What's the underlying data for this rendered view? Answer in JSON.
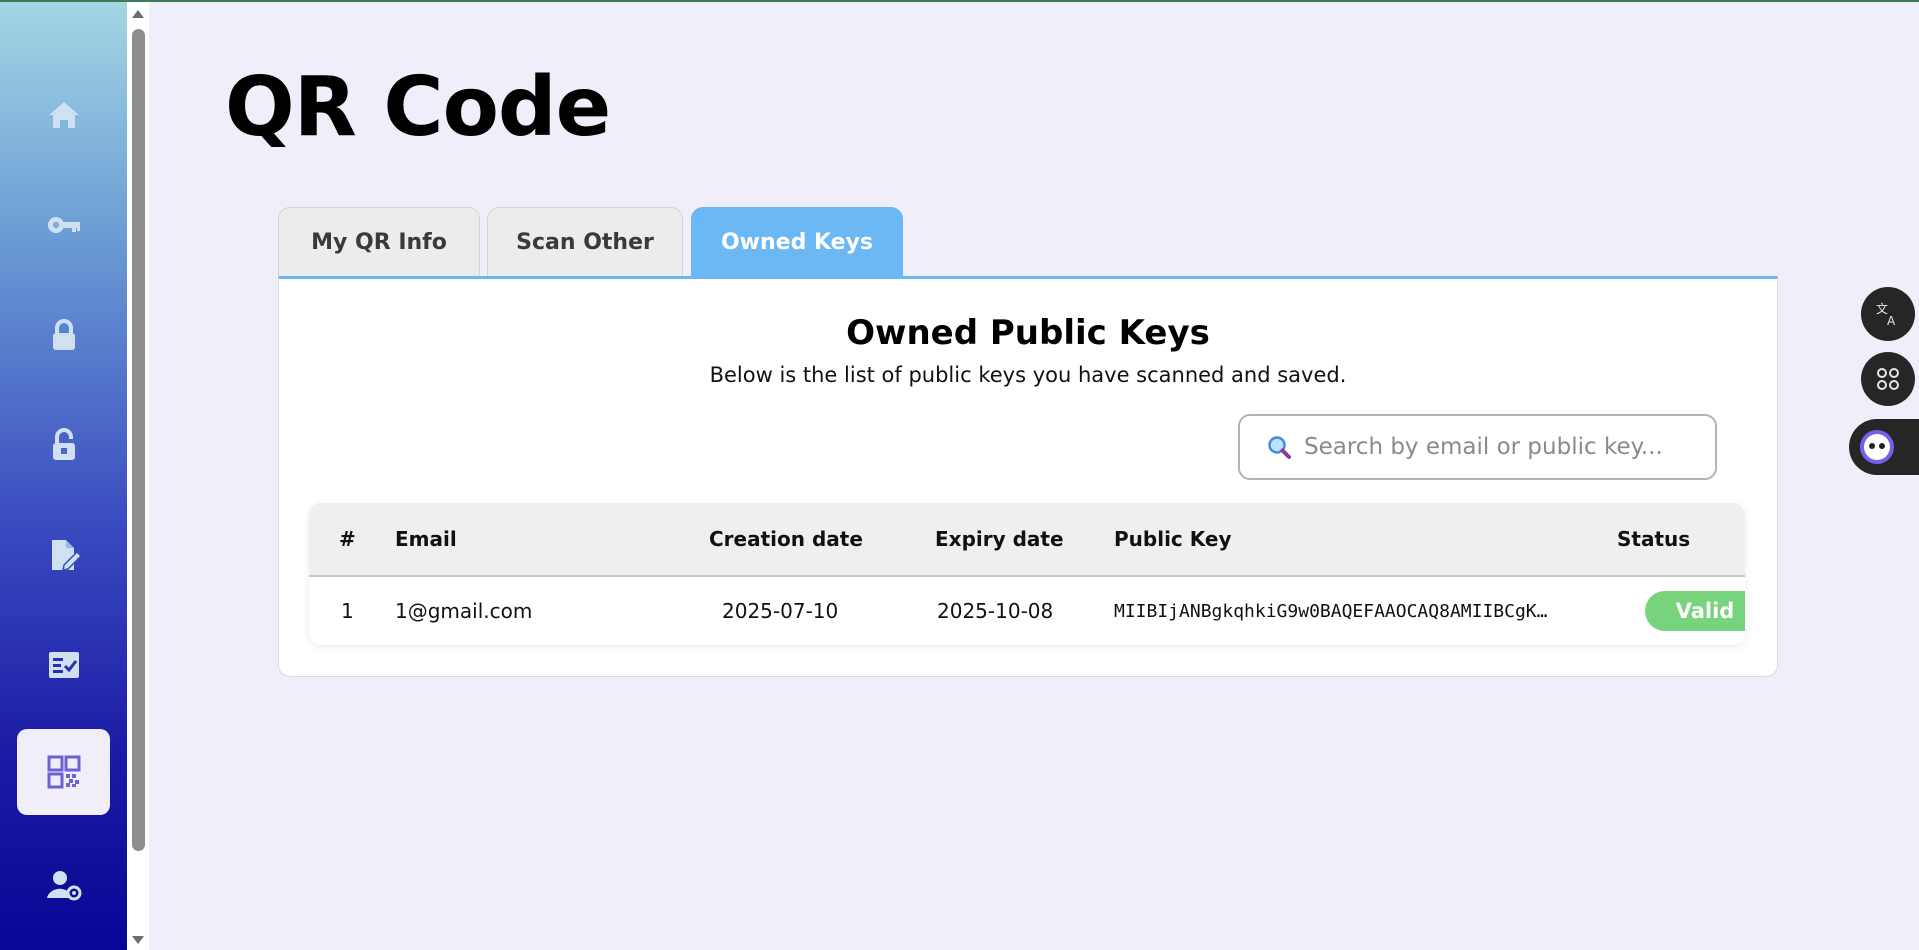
{
  "page": {
    "title": "QR Code"
  },
  "sidebar": {
    "items": [
      {
        "icon": "home-icon",
        "active": false
      },
      {
        "icon": "key-icon",
        "active": false
      },
      {
        "icon": "lock-icon",
        "active": false
      },
      {
        "icon": "unlock-icon",
        "active": false
      },
      {
        "icon": "sign-document-icon",
        "active": false
      },
      {
        "icon": "checklist-icon",
        "active": false
      },
      {
        "icon": "qr-code-icon",
        "active": true
      },
      {
        "icon": "user-settings-icon",
        "active": false
      }
    ]
  },
  "tabs": [
    {
      "label": "My QR Info",
      "active": false
    },
    {
      "label": "Scan Other",
      "active": false
    },
    {
      "label": "Owned Keys",
      "active": true
    }
  ],
  "panel": {
    "heading": "Owned Public Keys",
    "subtitle": "Below is the list of public keys you have scanned and saved.",
    "search": {
      "placeholder": "Search by email or public key...",
      "value": ""
    }
  },
  "table": {
    "columns": [
      "#",
      "Email",
      "Creation date",
      "Expiry date",
      "Public Key",
      "Status"
    ],
    "rows": [
      {
        "index": "1",
        "email": "1@gmail.com",
        "created": "2025-07-10",
        "expiry": "2025-10-08",
        "public_key": "MIIBIjANBgkqhkiG9w0BAQEFAAOCAQ8AMIIBCgK…",
        "status": "Valid"
      }
    ]
  },
  "colors": {
    "accent": "#6cb8f4",
    "valid": "#77d37c",
    "background": "#f0eff9",
    "sidebar_top": "#a4d6e4",
    "sidebar_bottom": "#070796"
  }
}
